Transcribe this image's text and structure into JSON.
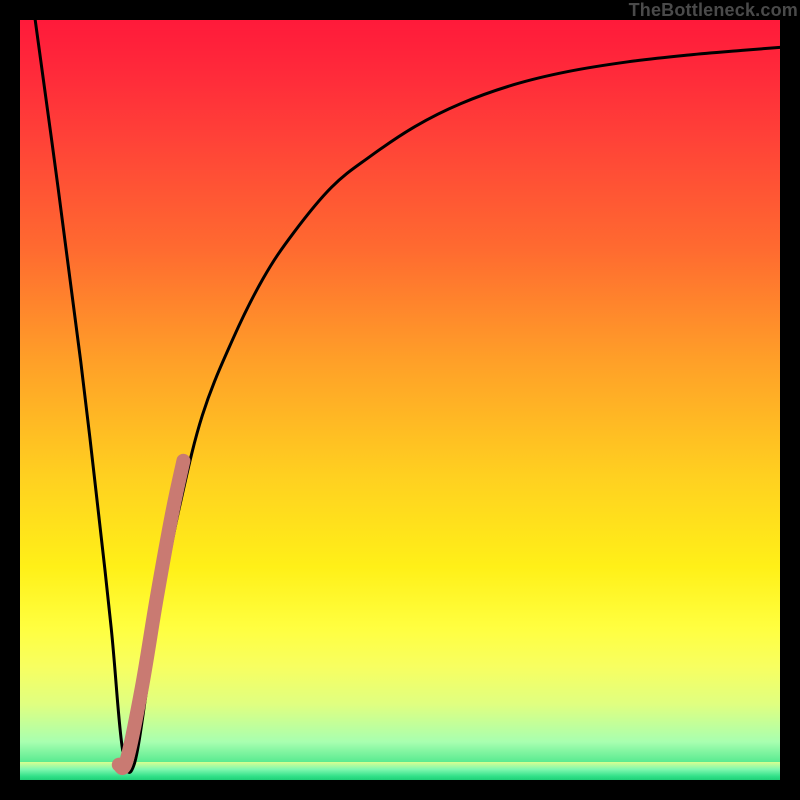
{
  "watermark": "TheBottleneck.com",
  "colors": {
    "curve": "#000000",
    "highlight": "#c97a72",
    "gradient_top": "#ff1a3a",
    "gradient_mid": "#ffd020",
    "gradient_bottom": "#20d878",
    "frame": "#000000"
  },
  "chart_data": {
    "type": "line",
    "title": "",
    "xlabel": "",
    "ylabel": "",
    "xlim": [
      0,
      100
    ],
    "ylim": [
      0,
      100
    ],
    "grid": false,
    "legend": false,
    "annotations": [],
    "series": [
      {
        "name": "curve",
        "x": [
          2,
          5,
          8,
          10,
          12,
          13.5,
          15,
          17,
          19,
          21,
          24,
          28,
          32,
          36,
          41,
          46,
          52,
          58,
          65,
          72,
          80,
          88,
          95,
          100
        ],
        "y": [
          100,
          78,
          55,
          38,
          20,
          4,
          2,
          14,
          26,
          36,
          48,
          58,
          66,
          72,
          78,
          82,
          86,
          89,
          91.5,
          93.2,
          94.5,
          95.4,
          96,
          96.4
        ]
      },
      {
        "name": "highlight_segment",
        "x": [
          13,
          14,
          16,
          18,
          20,
          21.5
        ],
        "y": [
          2,
          2.5,
          12,
          24,
          35,
          42
        ]
      }
    ],
    "notes": "Axes are unlabeled; values are read approximately from pixel positions normalized to 0-100. y=100 is top of plot (inside the red region), y=0 is bottom (green). The curve dips steeply from the top-left to a minimum near x≈14 then rises asymptotically toward the upper right. A thick muted-red segment overlays the rising portion just after the minimum."
  }
}
